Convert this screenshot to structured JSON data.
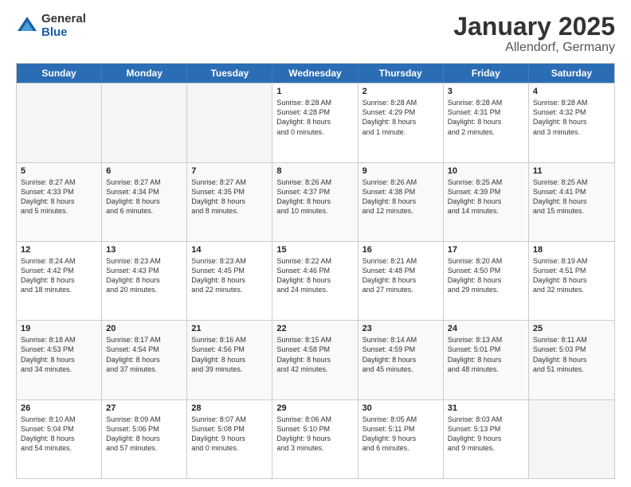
{
  "logo": {
    "general": "General",
    "blue": "Blue"
  },
  "title": "January 2025",
  "subtitle": "Allendorf, Germany",
  "header_days": [
    "Sunday",
    "Monday",
    "Tuesday",
    "Wednesday",
    "Thursday",
    "Friday",
    "Saturday"
  ],
  "rows": [
    [
      {
        "day": "",
        "text": "",
        "empty": true
      },
      {
        "day": "",
        "text": "",
        "empty": true
      },
      {
        "day": "",
        "text": "",
        "empty": true
      },
      {
        "day": "1",
        "text": "Sunrise: 8:28 AM\nSunset: 4:28 PM\nDaylight: 8 hours\nand 0 minutes.",
        "empty": false
      },
      {
        "day": "2",
        "text": "Sunrise: 8:28 AM\nSunset: 4:29 PM\nDaylight: 8 hours\nand 1 minute.",
        "empty": false
      },
      {
        "day": "3",
        "text": "Sunrise: 8:28 AM\nSunset: 4:31 PM\nDaylight: 8 hours\nand 2 minutes.",
        "empty": false
      },
      {
        "day": "4",
        "text": "Sunrise: 8:28 AM\nSunset: 4:32 PM\nDaylight: 8 hours\nand 3 minutes.",
        "empty": false
      }
    ],
    [
      {
        "day": "5",
        "text": "Sunrise: 8:27 AM\nSunset: 4:33 PM\nDaylight: 8 hours\nand 5 minutes.",
        "empty": false
      },
      {
        "day": "6",
        "text": "Sunrise: 8:27 AM\nSunset: 4:34 PM\nDaylight: 8 hours\nand 6 minutes.",
        "empty": false
      },
      {
        "day": "7",
        "text": "Sunrise: 8:27 AM\nSunset: 4:35 PM\nDaylight: 8 hours\nand 8 minutes.",
        "empty": false
      },
      {
        "day": "8",
        "text": "Sunrise: 8:26 AM\nSunset: 4:37 PM\nDaylight: 8 hours\nand 10 minutes.",
        "empty": false
      },
      {
        "day": "9",
        "text": "Sunrise: 8:26 AM\nSunset: 4:38 PM\nDaylight: 8 hours\nand 12 minutes.",
        "empty": false
      },
      {
        "day": "10",
        "text": "Sunrise: 8:25 AM\nSunset: 4:39 PM\nDaylight: 8 hours\nand 14 minutes.",
        "empty": false
      },
      {
        "day": "11",
        "text": "Sunrise: 8:25 AM\nSunset: 4:41 PM\nDaylight: 8 hours\nand 15 minutes.",
        "empty": false
      }
    ],
    [
      {
        "day": "12",
        "text": "Sunrise: 8:24 AM\nSunset: 4:42 PM\nDaylight: 8 hours\nand 18 minutes.",
        "empty": false
      },
      {
        "day": "13",
        "text": "Sunrise: 8:23 AM\nSunset: 4:43 PM\nDaylight: 8 hours\nand 20 minutes.",
        "empty": false
      },
      {
        "day": "14",
        "text": "Sunrise: 8:23 AM\nSunset: 4:45 PM\nDaylight: 8 hours\nand 22 minutes.",
        "empty": false
      },
      {
        "day": "15",
        "text": "Sunrise: 8:22 AM\nSunset: 4:46 PM\nDaylight: 8 hours\nand 24 minutes.",
        "empty": false
      },
      {
        "day": "16",
        "text": "Sunrise: 8:21 AM\nSunset: 4:48 PM\nDaylight: 8 hours\nand 27 minutes.",
        "empty": false
      },
      {
        "day": "17",
        "text": "Sunrise: 8:20 AM\nSunset: 4:50 PM\nDaylight: 8 hours\nand 29 minutes.",
        "empty": false
      },
      {
        "day": "18",
        "text": "Sunrise: 8:19 AM\nSunset: 4:51 PM\nDaylight: 8 hours\nand 32 minutes.",
        "empty": false
      }
    ],
    [
      {
        "day": "19",
        "text": "Sunrise: 8:18 AM\nSunset: 4:53 PM\nDaylight: 8 hours\nand 34 minutes.",
        "empty": false
      },
      {
        "day": "20",
        "text": "Sunrise: 8:17 AM\nSunset: 4:54 PM\nDaylight: 8 hours\nand 37 minutes.",
        "empty": false
      },
      {
        "day": "21",
        "text": "Sunrise: 8:16 AM\nSunset: 4:56 PM\nDaylight: 8 hours\nand 39 minutes.",
        "empty": false
      },
      {
        "day": "22",
        "text": "Sunrise: 8:15 AM\nSunset: 4:58 PM\nDaylight: 8 hours\nand 42 minutes.",
        "empty": false
      },
      {
        "day": "23",
        "text": "Sunrise: 8:14 AM\nSunset: 4:59 PM\nDaylight: 8 hours\nand 45 minutes.",
        "empty": false
      },
      {
        "day": "24",
        "text": "Sunrise: 8:13 AM\nSunset: 5:01 PM\nDaylight: 8 hours\nand 48 minutes.",
        "empty": false
      },
      {
        "day": "25",
        "text": "Sunrise: 8:11 AM\nSunset: 5:03 PM\nDaylight: 8 hours\nand 51 minutes.",
        "empty": false
      }
    ],
    [
      {
        "day": "26",
        "text": "Sunrise: 8:10 AM\nSunset: 5:04 PM\nDaylight: 8 hours\nand 54 minutes.",
        "empty": false
      },
      {
        "day": "27",
        "text": "Sunrise: 8:09 AM\nSunset: 5:06 PM\nDaylight: 8 hours\nand 57 minutes.",
        "empty": false
      },
      {
        "day": "28",
        "text": "Sunrise: 8:07 AM\nSunset: 5:08 PM\nDaylight: 9 hours\nand 0 minutes.",
        "empty": false
      },
      {
        "day": "29",
        "text": "Sunrise: 8:06 AM\nSunset: 5:10 PM\nDaylight: 9 hours\nand 3 minutes.",
        "empty": false
      },
      {
        "day": "30",
        "text": "Sunrise: 8:05 AM\nSunset: 5:11 PM\nDaylight: 9 hours\nand 6 minutes.",
        "empty": false
      },
      {
        "day": "31",
        "text": "Sunrise: 8:03 AM\nSunset: 5:13 PM\nDaylight: 9 hours\nand 9 minutes.",
        "empty": false
      },
      {
        "day": "",
        "text": "",
        "empty": true
      }
    ]
  ]
}
